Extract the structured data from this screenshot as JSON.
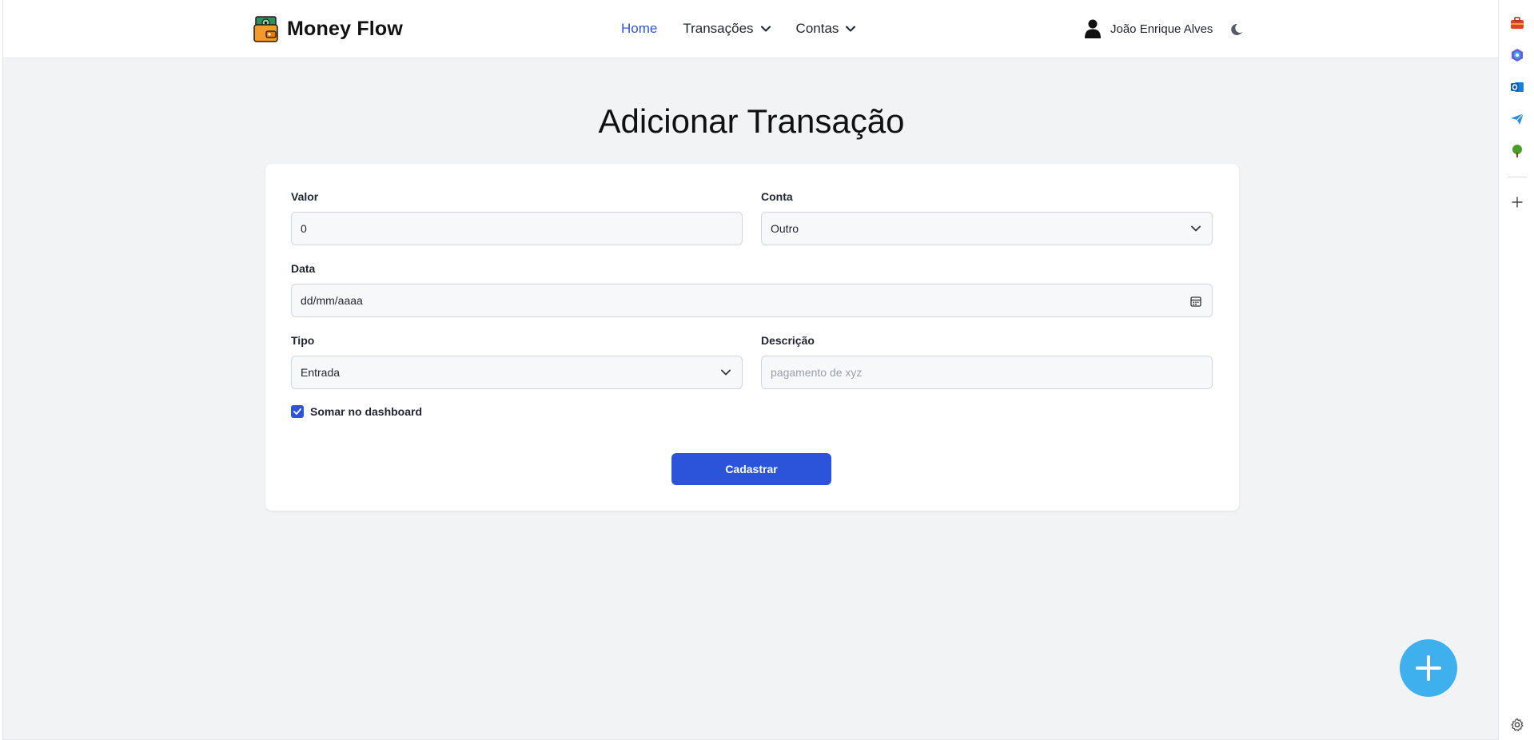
{
  "brand": {
    "name": "Money Flow"
  },
  "nav": {
    "home": "Home",
    "transactions": "Transações",
    "accounts": "Contas"
  },
  "user": {
    "name": "João Enrique Alves"
  },
  "page": {
    "title": "Adicionar Transação"
  },
  "form": {
    "valor": {
      "label": "Valor",
      "value": "0"
    },
    "conta": {
      "label": "Conta",
      "value": "Outro"
    },
    "data": {
      "label": "Data",
      "placeholder": "dd/mm/aaaa"
    },
    "tipo": {
      "label": "Tipo",
      "value": "Entrada"
    },
    "descricao": {
      "label": "Descrição",
      "placeholder": "pagamento de xyz"
    },
    "dashboard": {
      "label": "Somar no dashboard",
      "checked": true
    },
    "submit": "Cadastrar"
  },
  "colors": {
    "accent": "#2c54db",
    "fab": "#3fb0ee",
    "background": "#f2f3f5"
  },
  "icons": {
    "brand": "wallet-money-icon",
    "user": "user-icon",
    "theme": "moon-icon",
    "fab": "plus-icon",
    "sidebar": [
      "toolbox-icon",
      "copilot-icon",
      "outlook-icon",
      "send-icon",
      "tree-icon",
      "plus-icon",
      "settings-icon"
    ]
  }
}
